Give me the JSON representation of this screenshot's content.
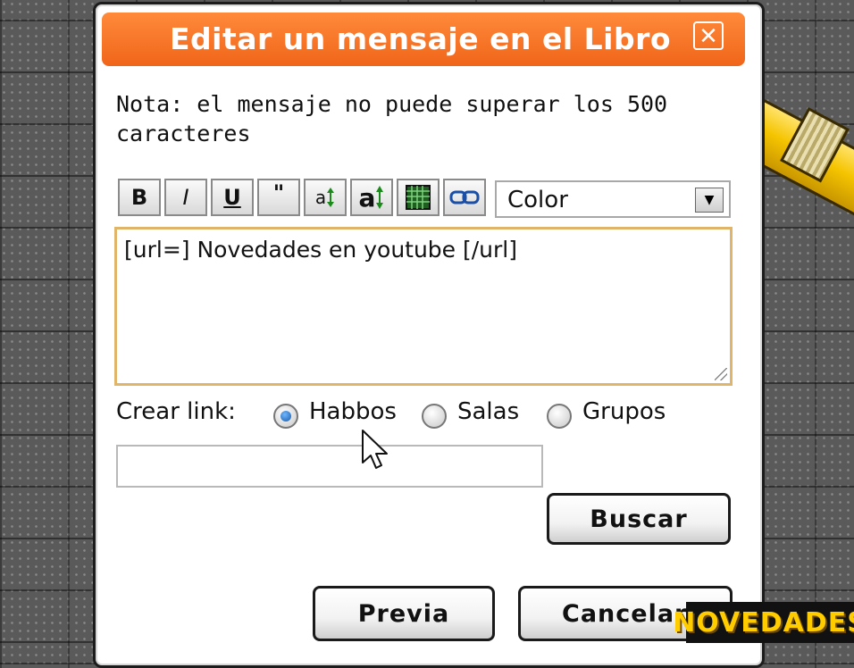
{
  "dialog": {
    "title": "Editar un mensaje en el Libro",
    "close_label": "✕",
    "note": "Nota: el mensaje no puede superar los 500 caracteres"
  },
  "toolbar": {
    "bold": "B",
    "italic": "I",
    "underline": "U",
    "quote": "\"",
    "font_smaller": "a",
    "font_bigger": "a",
    "color_select": {
      "selected": "Color"
    }
  },
  "editor": {
    "value": "[url=] Novedades en youtube [/url]"
  },
  "link": {
    "label": "Crear link:",
    "options": [
      {
        "label": "Habbos",
        "checked": true
      },
      {
        "label": "Salas",
        "checked": false
      },
      {
        "label": "Grupos",
        "checked": false
      }
    ],
    "input_value": "",
    "search_button": "Buscar"
  },
  "actions": {
    "preview": "Previa",
    "cancel": "Cancelar"
  },
  "watermark": "NOVEDADES",
  "colors": {
    "titlebar": "#f0651a",
    "textarea_border": "#e0b56a",
    "radio_checked": "#1a5aa8"
  }
}
